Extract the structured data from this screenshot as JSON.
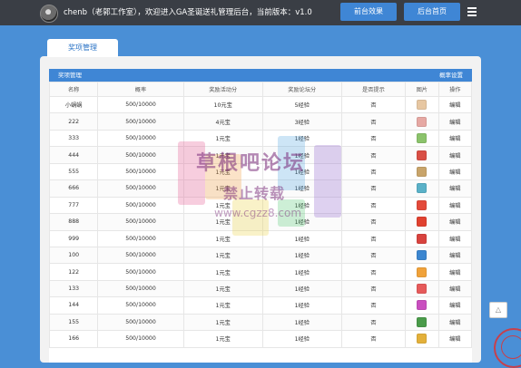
{
  "header": {
    "welcome": "chenb（老郭工作室），欢迎进入GA圣诞送礼管理后台，当前版本：v1.0",
    "btn_front": "前台效果",
    "btn_home": "后台首页"
  },
  "tab": {
    "label": "奖项管理"
  },
  "card": {
    "title": "奖项管理",
    "settings": "概率设置"
  },
  "table": {
    "headers": [
      "名称",
      "概率",
      "奖励活动分",
      "奖励论坛分",
      "是否提示",
      "图片",
      "操作"
    ],
    "rows": [
      {
        "name": "小蜗蜗",
        "prob": "500/10000",
        "act": "10元宝",
        "forum": "5经验",
        "tip": "否",
        "op": "编辑",
        "color": "#e7c7a2"
      },
      {
        "name": "222",
        "prob": "500/10000",
        "act": "4元宝",
        "forum": "3经验",
        "tip": "否",
        "op": "编辑",
        "color": "#e6a8a3"
      },
      {
        "name": "333",
        "prob": "500/10000",
        "act": "1元宝",
        "forum": "1经验",
        "tip": "否",
        "op": "编辑",
        "color": "#8bc36b"
      },
      {
        "name": "444",
        "prob": "500/10000",
        "act": "1元宝",
        "forum": "1经验",
        "tip": "否",
        "op": "编辑",
        "color": "#d94f45"
      },
      {
        "name": "555",
        "prob": "500/10000",
        "act": "1元宝",
        "forum": "1经验",
        "tip": "否",
        "op": "编辑",
        "color": "#c8a46a"
      },
      {
        "name": "666",
        "prob": "500/10000",
        "act": "1元宝",
        "forum": "1经验",
        "tip": "否",
        "op": "编辑",
        "color": "#5ab1c8"
      },
      {
        "name": "777",
        "prob": "500/10000",
        "act": "1元宝",
        "forum": "1经验",
        "tip": "否",
        "op": "编辑",
        "color": "#e34a3a"
      },
      {
        "name": "888",
        "prob": "500/10000",
        "act": "1元宝",
        "forum": "1经验",
        "tip": "否",
        "op": "编辑",
        "color": "#e0412f"
      },
      {
        "name": "999",
        "prob": "500/10000",
        "act": "1元宝",
        "forum": "1经验",
        "tip": "否",
        "op": "编辑",
        "color": "#d8433e"
      },
      {
        "name": "100",
        "prob": "500/10000",
        "act": "1元宝",
        "forum": "1经验",
        "tip": "否",
        "op": "编辑",
        "color": "#3c86d0"
      },
      {
        "name": "122",
        "prob": "500/10000",
        "act": "1元宝",
        "forum": "1经验",
        "tip": "否",
        "op": "编辑",
        "color": "#f0a23a"
      },
      {
        "name": "133",
        "prob": "500/10000",
        "act": "1元宝",
        "forum": "1经验",
        "tip": "否",
        "op": "编辑",
        "color": "#e65a5a"
      },
      {
        "name": "144",
        "prob": "500/10000",
        "act": "1元宝",
        "forum": "1经验",
        "tip": "否",
        "op": "编辑",
        "color": "#c94fbf"
      },
      {
        "name": "155",
        "prob": "500/10000",
        "act": "1元宝",
        "forum": "1经验",
        "tip": "否",
        "op": "编辑",
        "color": "#4a9b4a"
      },
      {
        "name": "166",
        "prob": "500/10000",
        "act": "1元宝",
        "forum": "1经验",
        "tip": "否",
        "op": "编辑",
        "color": "#e3b03a"
      }
    ]
  },
  "watermark": {
    "line1": "草根吧论坛",
    "line2": "禁止转载",
    "line3": "www.cgzz8.com"
  },
  "scroll_top": "△"
}
